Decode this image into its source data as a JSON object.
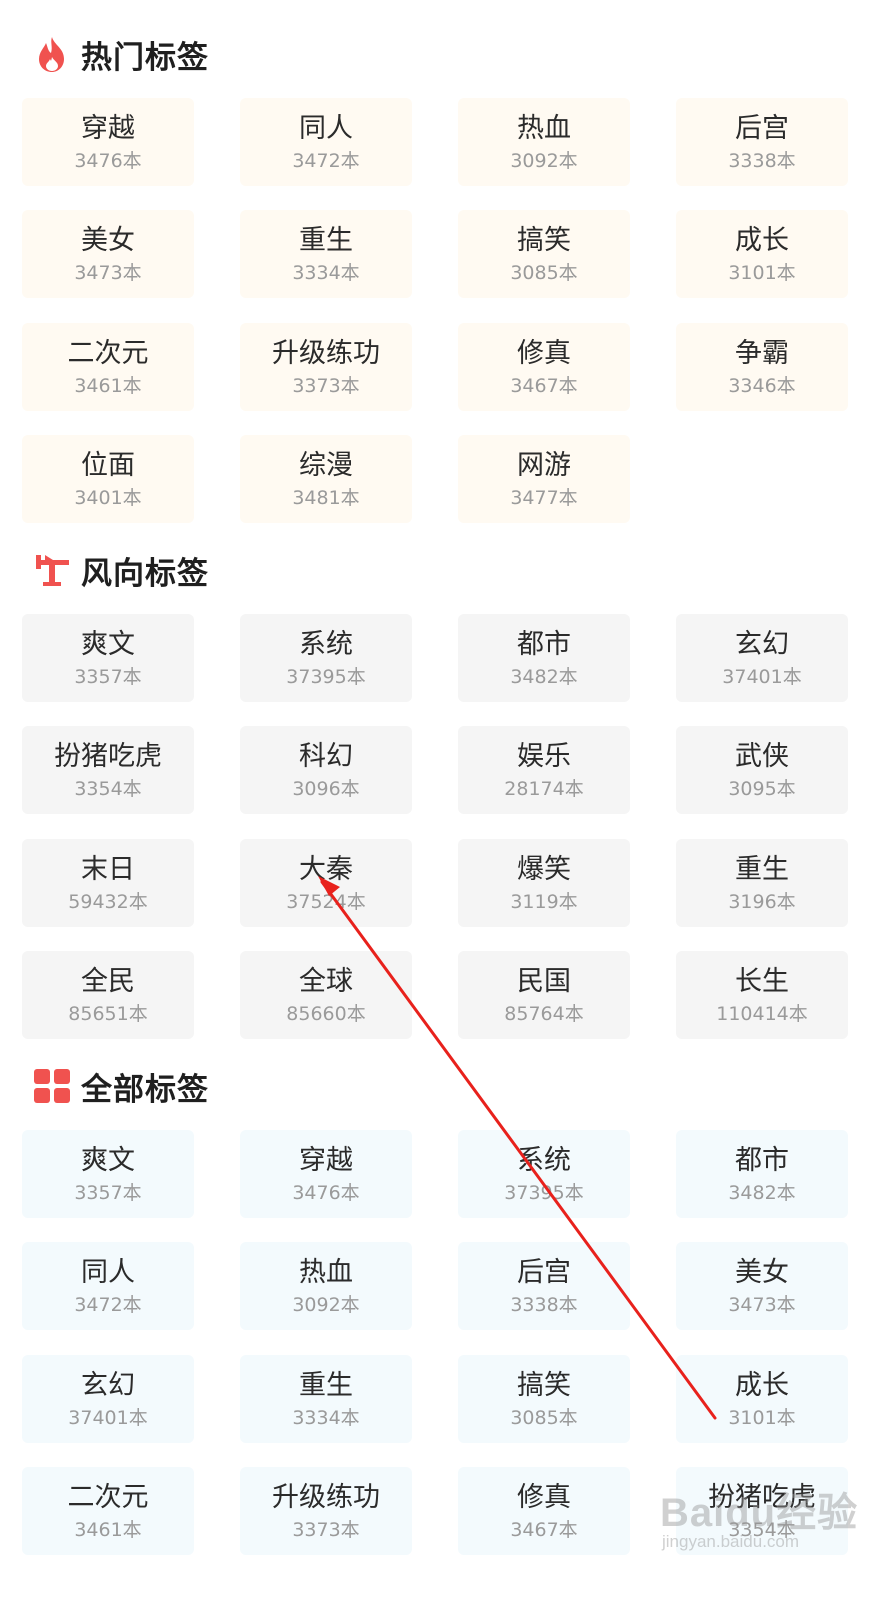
{
  "colors": {
    "accent": "#f0524f",
    "arrow": "#e8211c"
  },
  "sections": [
    {
      "title": "热门标签",
      "icon": "flame-icon",
      "tags": [
        {
          "name": "穿越",
          "count": "3476本"
        },
        {
          "name": "同人",
          "count": "3472本"
        },
        {
          "name": "热血",
          "count": "3092本"
        },
        {
          "name": "后宫",
          "count": "3338本"
        },
        {
          "name": "美女",
          "count": "3473本"
        },
        {
          "name": "重生",
          "count": "3334本"
        },
        {
          "name": "搞笑",
          "count": "3085本"
        },
        {
          "name": "成长",
          "count": "3101本"
        },
        {
          "name": "二次元",
          "count": "3461本"
        },
        {
          "name": "升级练功",
          "count": "3373本"
        },
        {
          "name": "修真",
          "count": "3467本"
        },
        {
          "name": "争霸",
          "count": "3346本"
        },
        {
          "name": "位面",
          "count": "3401本"
        },
        {
          "name": "综漫",
          "count": "3481本"
        },
        {
          "name": "网游",
          "count": "3477本"
        }
      ]
    },
    {
      "title": "风向标签",
      "icon": "weathervane-icon",
      "tags": [
        {
          "name": "爽文",
          "count": "3357本"
        },
        {
          "name": "系统",
          "count": "37395本"
        },
        {
          "name": "都市",
          "count": "3482本"
        },
        {
          "name": "玄幻",
          "count": "37401本"
        },
        {
          "name": "扮猪吃虎",
          "count": "3354本"
        },
        {
          "name": "科幻",
          "count": "3096本"
        },
        {
          "name": "娱乐",
          "count": "28174本"
        },
        {
          "name": "武侠",
          "count": "3095本"
        },
        {
          "name": "末日",
          "count": "59432本"
        },
        {
          "name": "大秦",
          "count": "37524本"
        },
        {
          "name": "爆笑",
          "count": "3119本"
        },
        {
          "name": "重生",
          "count": "3196本"
        },
        {
          "name": "全民",
          "count": "85651本"
        },
        {
          "name": "全球",
          "count": "85660本"
        },
        {
          "name": "民国",
          "count": "85764本"
        },
        {
          "name": "长生",
          "count": "110414本"
        }
      ]
    },
    {
      "title": "全部标签",
      "icon": "grid-icon",
      "tags": [
        {
          "name": "爽文",
          "count": "3357本"
        },
        {
          "name": "穿越",
          "count": "3476本"
        },
        {
          "name": "系统",
          "count": "37395本"
        },
        {
          "name": "都市",
          "count": "3482本"
        },
        {
          "name": "同人",
          "count": "3472本"
        },
        {
          "name": "热血",
          "count": "3092本"
        },
        {
          "name": "后宫",
          "count": "3338本"
        },
        {
          "name": "美女",
          "count": "3473本"
        },
        {
          "name": "玄幻",
          "count": "37401本"
        },
        {
          "name": "重生",
          "count": "3334本"
        },
        {
          "name": "搞笑",
          "count": "3085本"
        },
        {
          "name": "成长",
          "count": "3101本"
        },
        {
          "name": "二次元",
          "count": "3461本"
        },
        {
          "name": "升级练功",
          "count": "3373本"
        },
        {
          "name": "修真",
          "count": "3467本"
        },
        {
          "name": "扮猪吃虎",
          "count": "3354本"
        }
      ]
    }
  ],
  "watermark": {
    "brand": "Baidu经验",
    "url": "jingyan.baidu.com"
  }
}
